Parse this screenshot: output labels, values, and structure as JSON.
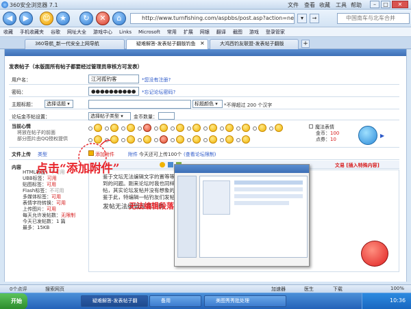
{
  "browser": {
    "title": "360安全浏览器 7.1",
    "menu": [
      "文件",
      "查看",
      "收藏",
      "工具",
      "帮助"
    ],
    "address": "http://www.turnfishing.com/aspbbs/post.asp?action=new&b",
    "search_placeholder": "中国南车与北车合并"
  },
  "favorites": [
    "收藏",
    "手机收藏夹",
    "谷歌",
    "网址大全",
    "游戏中心",
    "Links",
    "Microsoft",
    "常用",
    "扩展",
    "网银",
    "翻译",
    "截图",
    "游戏",
    "登录管家"
  ],
  "tabs": [
    {
      "label": "360导航_新一代安全上网导航",
      "active": false
    },
    {
      "label": "疑难解答-发表帖子翻版钓鱼",
      "active": true
    },
    {
      "label": "大鸿西钓友联盟-发表帖子翻版",
      "active": false
    }
  ],
  "form": {
    "header": "发表帖子（本版面所有帖子都要经过管理员审核方可发表）",
    "username_label": "用户名：",
    "username_value": "江河孤钓客",
    "username_link": "*您没有注册?",
    "password_label": "密码：",
    "password_value": "●●●●●●●●●●",
    "password_link": "*忘记论坛密码?",
    "subject_label": "主题标题：",
    "subject_select": "选择话题",
    "subject_hint": "*不得超过 200 个汉字",
    "subject_select2": "标题颜色",
    "gold_label": "论坛金币帖设置：",
    "gold_select": "选择帖子类型",
    "gold_count_label": "金币数量：",
    "mood_label": "当前心情",
    "mood_sub1": "将放在帖子的前面",
    "mood_sub2": "部分图片由QQ授权提供",
    "magic_label": "魔法表情",
    "gold_stat": "金币：",
    "gold_value": "100",
    "points_stat": "点券：",
    "points_value": "10",
    "upload_label": "文件上传",
    "upload_type": "类型",
    "add_attachment": "添加附件",
    "attach2": "附件",
    "upload_info": "今天还可上传100个",
    "upload_limit": "(查看论坛限制)",
    "content_label": "内容",
    "content_props": [
      {
        "k": "HTML标签：",
        "v": "不可用"
      },
      {
        "k": "UBB标签：",
        "v": "可用"
      },
      {
        "k": "贴图标签：",
        "v": "可用"
      },
      {
        "k": "Flash标签：",
        "v": "不可用"
      },
      {
        "k": "多媒体标签：",
        "v": "可用"
      },
      {
        "k": "表情字符转换：",
        "v": "可用"
      },
      {
        "k": "上传图片：",
        "v": "可用"
      },
      {
        "k": "每天允许发帖数：",
        "v": "无限制"
      },
      {
        "k": "今天已发帖数：",
        "v": "1 篇"
      },
      {
        "k": "最多：",
        "v": "15KB"
      }
    ],
    "editor_right1": "文易 [插入特殊内容]",
    "editor_text": [
      "鉴于文坛无法编辑文字的置等等。这是钓友们普遍遇",
      "到的问题。刚来论坛时我也同样是，但是通过后期的学习、爬",
      "帖，其实论坛发帖并没有想象的那",
      "鉴于此，特编辑一帖钓友们发帖",
      "发帖无法编辑段落正确"
    ],
    "callout": "点击“添加附件”",
    "red_text": "无法编辑段落"
  },
  "statusbar": {
    "left": "0个点评",
    "center": "搜索网页",
    "right": [
      "加速器",
      "医生",
      "下载",
      "100%"
    ]
  },
  "taskbar": {
    "start": "开始",
    "tasks": [
      {
        "label": "疑难解答-发表帖子翻",
        "active": true
      },
      {
        "label": "备用",
        "active": false
      },
      {
        "label": "美图秀秀批处理",
        "active": false
      }
    ],
    "time": "10:36"
  },
  "colors": {
    "accent": "#3d6fb6",
    "link": "#2a57c8",
    "warning": "#d61a1a",
    "callout": "#e8242b"
  }
}
